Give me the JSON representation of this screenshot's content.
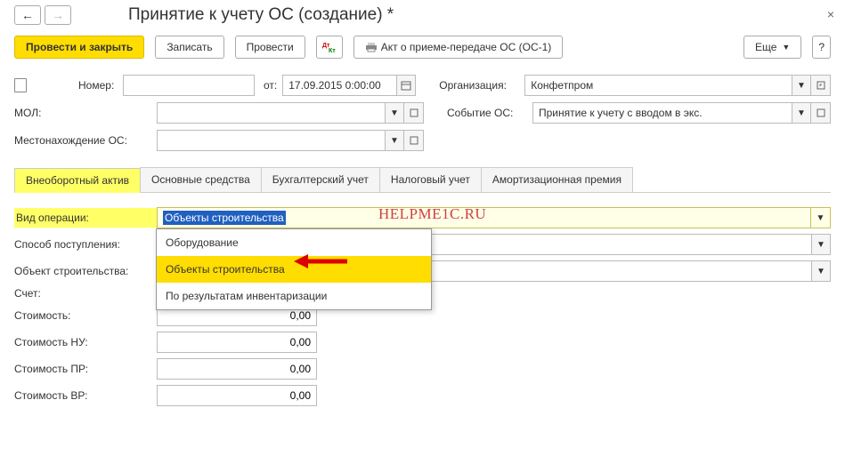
{
  "header": {
    "title": "Принятие к учету ОС (создание) *"
  },
  "toolbar": {
    "post_close": "Провести и закрыть",
    "save": "Записать",
    "post": "Провести",
    "print_act": "Акт о приеме-передаче ОС (ОС-1)",
    "more": "Еще"
  },
  "form": {
    "number_label": "Номер:",
    "number_value": "",
    "from_label": "от:",
    "date_value": "17.09.2015 0:00:00",
    "org_label": "Организация:",
    "org_value": "Конфетпром",
    "mol_label": "МОЛ:",
    "mol_value": "",
    "event_label": "Событие ОС:",
    "event_value": "Принятие к учету с вводом в экс.",
    "location_label": "Местонахождение ОС:",
    "location_value": ""
  },
  "tabs": [
    "Внеоборотный актив",
    "Основные средства",
    "Бухгалтерский учет",
    "Налоговый учет",
    "Амортизационная премия"
  ],
  "panel": {
    "operation_type_label": "Вид операции:",
    "operation_type_value": "Объекты строительства",
    "receipt_method_label": "Способ поступления:",
    "construction_obj_label": "Объект строительства:",
    "account_label": "Счет:",
    "cost_label": "Стоимость:",
    "cost_nu_label": "Стоимость НУ:",
    "cost_pr_label": "Стоимость ПР:",
    "cost_vr_label": "Стоимость ВР:",
    "zero": "0,00",
    "options": [
      "Оборудование",
      "Объекты строительства",
      "По результатам инвентаризации"
    ]
  },
  "watermark": "HELPME1C.RU"
}
